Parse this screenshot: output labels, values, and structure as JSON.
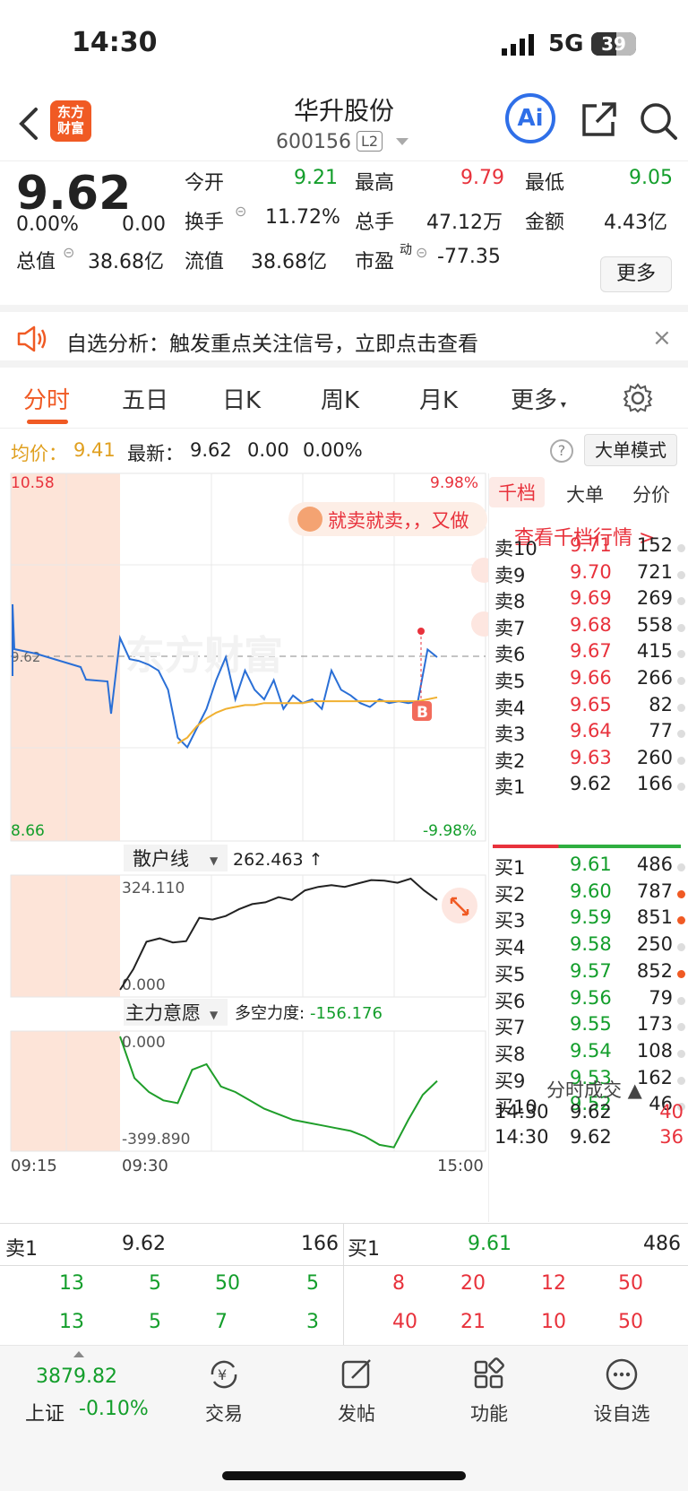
{
  "status": {
    "time": "14:30",
    "network": "5G",
    "battery": "39"
  },
  "header": {
    "title": "华升股份",
    "code": "600156",
    "level": "L2",
    "logo_text": "东方财富",
    "ai_label": "Ai"
  },
  "quote": {
    "price": "9.62",
    "change_pct": "0.00%",
    "change": "0.00",
    "open_label": "今开",
    "open": "9.21",
    "high_label": "最高",
    "high": "9.79",
    "low_label": "最低",
    "low": "9.05",
    "turnover_label": "换手",
    "turnover": "11.72%",
    "volume_label": "总手",
    "volume": "47.12万",
    "amount_label": "金额",
    "amount": "4.43亿",
    "mcap_label": "总值",
    "mcap": "38.68亿",
    "float_label": "流值",
    "float": "38.68亿",
    "pe_label": "市盈",
    "pe_sup": "动",
    "pe": "-77.35",
    "more": "更多"
  },
  "notice": {
    "text": "自选分析：触发重点关注信号，立即点击查看",
    "close": "×"
  },
  "tabs": [
    "分时",
    "五日",
    "日K",
    "周K",
    "月K",
    "更多"
  ],
  "info": {
    "avg_label": "均价：",
    "avg": "9.41",
    "latest_label": "最新：",
    "latest": "9.62",
    "chg": "0.00",
    "pct": "0.00%",
    "help": "?",
    "big_order": "大单模式"
  },
  "chart_labels": {
    "ymax": "10.58",
    "ymin": "8.66",
    "pct_max": "9.98%",
    "pct_min": "-9.98%",
    "ref": "9.62",
    "bubble": "就卖就卖，，又做",
    "watermark": "东方财富",
    "retail_label": "散户线",
    "retail_value": "262.463 ↑",
    "retail_max": "324.110",
    "retail_min": "0.000",
    "main_label": "主力意愿",
    "main_sub": "多空力度:",
    "main_value": "-156.176",
    "main_max": "0.000",
    "main_min": "-399.890",
    "t0": "09:15",
    "t1": "09:30",
    "t2": "15:00",
    "buy_marker": "B"
  },
  "chart_data": {
    "type": "line",
    "series": [
      {
        "name": "price",
        "values": [
          9.72,
          9.61,
          9.6,
          9.58,
          9.55,
          9.45,
          9.2,
          9.15,
          9.25,
          9.35,
          9.5,
          9.62,
          9.4,
          9.55,
          9.45,
          9.4,
          9.5,
          9.35,
          9.42,
          9.38,
          9.4,
          9.35,
          9.55,
          9.45,
          9.42,
          9.38,
          9.36,
          9.4,
          9.38,
          9.39,
          9.38,
          9.39,
          9.66,
          9.62
        ]
      },
      {
        "name": "avg",
        "values": [
          null,
          null,
          null,
          null,
          null,
          null,
          9.17,
          9.2,
          9.26,
          9.3,
          9.33,
          9.35,
          9.36,
          9.37,
          9.37,
          9.38,
          9.38,
          9.38,
          9.38,
          9.38,
          9.39,
          9.39,
          9.39,
          9.39,
          9.39,
          9.39,
          9.39,
          9.39,
          9.39,
          9.39,
          9.39,
          9.39,
          9.4,
          9.41
        ]
      }
    ],
    "ylim": [
      8.66,
      10.58
    ],
    "retail": [
      0,
      60,
      140,
      150,
      138,
      142,
      210,
      205,
      215,
      235,
      250,
      255,
      270,
      262,
      290,
      300,
      305,
      300,
      310,
      320,
      318,
      312,
      324,
      290,
      262
    ],
    "retail_ylim": [
      0,
      324.11
    ],
    "main_force": [
      0,
      -150,
      -200,
      -230,
      -240,
      -120,
      -100,
      -180,
      -200,
      -230,
      -260,
      -280,
      -300,
      -310,
      -320,
      -330,
      -340,
      -360,
      -390,
      -399,
      -300,
      -210,
      -160
    ],
    "main_ylim": [
      -399.89,
      0
    ]
  },
  "book": {
    "tabs": [
      "千档",
      "大单",
      "分价"
    ],
    "link": "查看千档行情 >",
    "asks": [
      {
        "name": "卖10",
        "price": "9.71",
        "vol": "152"
      },
      {
        "name": "卖9",
        "price": "9.70",
        "vol": "721"
      },
      {
        "name": "卖8",
        "price": "9.69",
        "vol": "269"
      },
      {
        "name": "卖7",
        "price": "9.68",
        "vol": "558"
      },
      {
        "name": "卖6",
        "price": "9.67",
        "vol": "415"
      },
      {
        "name": "卖5",
        "price": "9.66",
        "vol": "266"
      },
      {
        "name": "卖4",
        "price": "9.65",
        "vol": "82"
      },
      {
        "name": "卖3",
        "price": "9.64",
        "vol": "77"
      },
      {
        "name": "卖2",
        "price": "9.63",
        "vol": "260"
      },
      {
        "name": "卖1",
        "price": "9.62",
        "vol": "166"
      }
    ],
    "bids": [
      {
        "name": "买1",
        "price": "9.61",
        "vol": "486"
      },
      {
        "name": "买2",
        "price": "9.60",
        "vol": "787"
      },
      {
        "name": "买3",
        "price": "9.59",
        "vol": "851"
      },
      {
        "name": "买4",
        "price": "9.58",
        "vol": "250"
      },
      {
        "name": "买5",
        "price": "9.57",
        "vol": "852"
      },
      {
        "name": "买6",
        "price": "9.56",
        "vol": "79"
      },
      {
        "name": "买7",
        "price": "9.55",
        "vol": "173"
      },
      {
        "name": "买8",
        "price": "9.54",
        "vol": "108"
      },
      {
        "name": "买9",
        "price": "9.53",
        "vol": "162"
      },
      {
        "name": "买10",
        "price": "9.52",
        "vol": "46"
      }
    ],
    "ticks_head": "分时成交 ▲",
    "ticks": [
      {
        "time": "14:30",
        "price": "9.62",
        "vol": "40"
      },
      {
        "time": "14:30",
        "price": "9.62",
        "vol": "36"
      }
    ]
  },
  "btable": {
    "sell_label": "卖1",
    "sell_price": "9.62",
    "sell_vol": "166",
    "buy_label": "买1",
    "buy_price": "9.61",
    "buy_vol": "486",
    "sell_rows": [
      [
        "13",
        "5",
        "50",
        "5"
      ],
      [
        "13",
        "5",
        "7",
        "3"
      ]
    ],
    "buy_rows": [
      [
        "8",
        "20",
        "12",
        "50"
      ],
      [
        "40",
        "21",
        "10",
        "50"
      ]
    ]
  },
  "nav": {
    "index_value": "3879.82",
    "index_name": "上证",
    "index_pct": "-0.10%",
    "items": [
      "交易",
      "发帖",
      "功能",
      "设自选"
    ]
  }
}
